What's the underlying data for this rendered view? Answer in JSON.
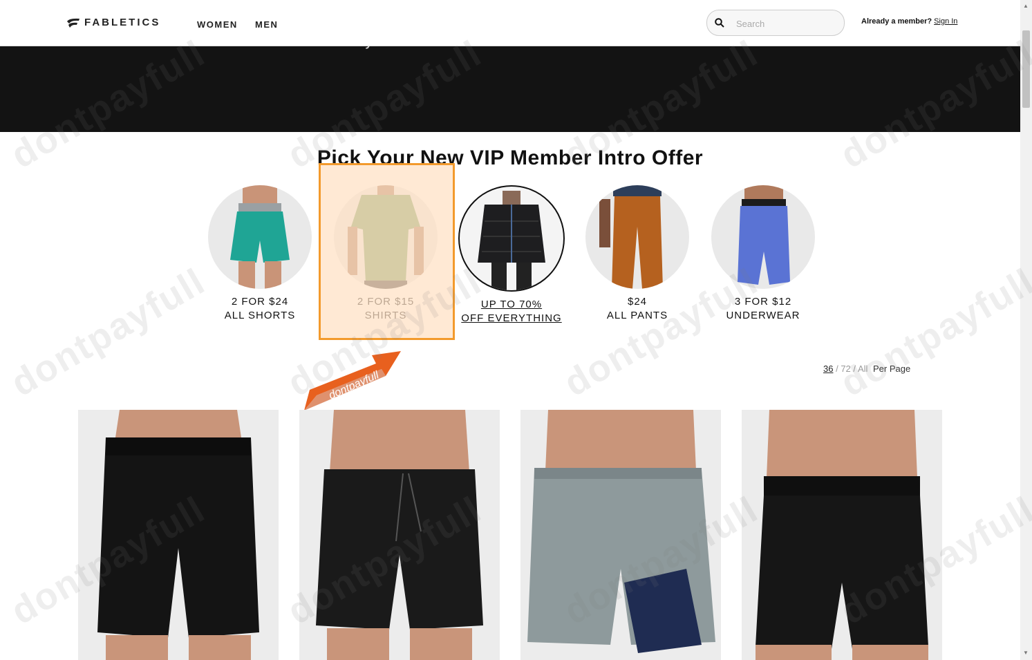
{
  "header": {
    "brand": "FABLETICS",
    "nav": [
      {
        "label": "WOMEN"
      },
      {
        "label": "MEN"
      }
    ],
    "search_placeholder": "Search",
    "member_question": "Already a member?",
    "sign_in": "Sign In"
  },
  "banner": {
    "text": "Don't Miss These Limited-Time Only New VIP Member Offers."
  },
  "offers": {
    "title": "Pick Your New VIP Member Intro Offer",
    "items": [
      {
        "line1": "2 FOR $24",
        "line2": "ALL SHORTS"
      },
      {
        "line1": "2 FOR $15",
        "line2": "SHIRTS"
      },
      {
        "line1": "UP TO 70%",
        "line2": "OFF EVERYTHING"
      },
      {
        "line1": "$24",
        "line2": "ALL PANTS"
      },
      {
        "line1": "3 FOR $12",
        "line2": "UNDERWEAR"
      }
    ]
  },
  "perpage": {
    "current": "36",
    "options": [
      "72",
      "All"
    ],
    "label": "Per Page"
  },
  "stamp": {
    "text": "dontpayfull"
  },
  "watermark": {
    "text": "dontpayfull"
  },
  "colors": {
    "highlight": "#f39a2c",
    "banner": "#131313"
  }
}
